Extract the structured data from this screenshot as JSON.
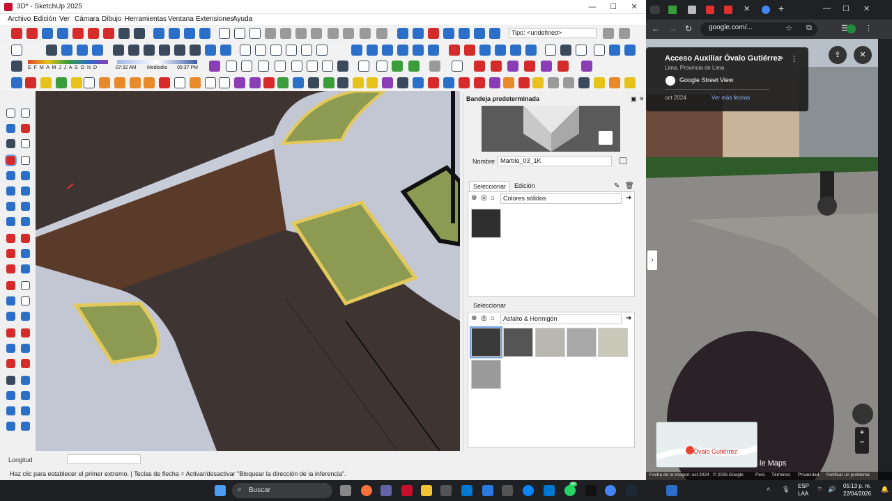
{
  "sketchup": {
    "title": "3D* - SketchUp 2025",
    "menu": [
      "Archivo",
      "Edición",
      "Ver",
      "Cámara",
      "Dibujo",
      "Herramientas",
      "Ventana",
      "Extensiones",
      "Ayuda"
    ],
    "tipo_placeholder": "Tipo: <undefined>",
    "shadow_months": "E F M A M J J A S O N D",
    "time_start": "07:32 AM",
    "time_mid": "Mediodía",
    "time_end": "05:37 PM",
    "tray_title": "Bandeja predeterminada",
    "name_label": "Nombre",
    "name_value": "Marble_03_1K",
    "tab_select": "Seleccionar",
    "tab_edit": "Edición",
    "collection1": "Colores sólidos",
    "select2": "Seleccionar",
    "collection2": "Asfalto & Hormigón",
    "longitud_label": "Longitud",
    "hint": "Haz clic para establecer el primer extremo. | Teclas de flecha = Activar/desactivar \"Bloquear la dirección de la inferencia\"."
  },
  "chrome": {
    "url": "google.com/...",
    "place": "Acceso Auxiliar Óvalo Gutiérrez",
    "location": "Lima, Provincia de Lima",
    "gsv_label": "Google Street View",
    "date": "oct 2024",
    "more_dates": "Ver más fechas",
    "minimap_label": "Óvalo Gutiérrez",
    "maps_brand": "le Maps",
    "footer_date": "Fecha de la imagen: oct 2024",
    "footer_copy": "© 2026 Google",
    "footer_peru": "Perú",
    "footer_terms": "Términos",
    "footer_privacy": "Privacidad",
    "footer_report": "Notificar un problema"
  },
  "taskbar": {
    "search": "Buscar",
    "lang1": "ESP",
    "lang2": "LAA",
    "time": "05:13 p. m.",
    "date": "22/04/2026",
    "badge": "40"
  },
  "colors": {
    "accent": "#2c6fc9",
    "asphalt": "#3e3532",
    "paving": "#c8ccd8",
    "dirt": "#5a3a28",
    "grass": "#8c9a52",
    "curb": "#e3c95a"
  }
}
